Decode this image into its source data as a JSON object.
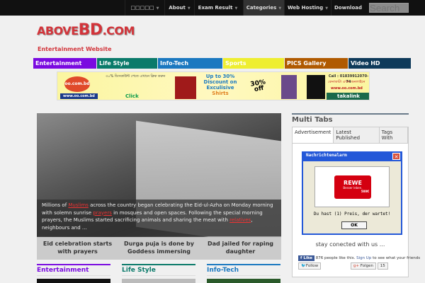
{
  "nav": {
    "items": [
      {
        "label": "□□□□□",
        "caret": true
      },
      {
        "label": "About",
        "caret": true
      },
      {
        "label": "Exam Result",
        "caret": true
      },
      {
        "label": "Categories",
        "caret": true
      },
      {
        "label": "Web Hosting",
        "caret": true
      },
      {
        "label": "Download",
        "caret": false
      }
    ],
    "search_placeholder": "Search"
  },
  "logo": {
    "prefix": "ABOVE",
    "main": "BD",
    "suffix": ".COM"
  },
  "tagline": "Entertainment Website",
  "categories": [
    {
      "label": "Entertainment",
      "color": "#7a0ae0"
    },
    {
      "label": "Life Style",
      "color": "#0a7a6a"
    },
    {
      "label": "Info-Tech",
      "color": "#1a78c0"
    },
    {
      "label": "Sports",
      "color": "#eeee30"
    },
    {
      "label": "PICS Gallery",
      "color": "#b05a00"
    },
    {
      "label": "Video HD",
      "color": "#0e3a5a"
    }
  ],
  "banner": {
    "site": "oo.com.bd",
    "url": "www.oo.com.bd",
    "bangla": "৩০% ডিসকাউন্ট পেতে এখানে ক্লিক করুন",
    "click": "Click",
    "promo1": "Up to 30%",
    "promo2": "Discount on",
    "promo3": "Exculisive",
    "promo4": "Shirts",
    "badge": "30% off",
    "call": "Call : 01839912070-74",
    "call_bn": "কেনাকাটা এখন অনলাইনে",
    "url2": "www.oo.com.bd",
    "takalink": "takalink"
  },
  "slider": {
    "caption_parts": [
      "Millions of ",
      "Muslims",
      " across the country began celebrating the Eid-ul-Azha on Monday morning with solemn sunrise ",
      "prayers",
      " in mosques and open spaces. Following the special morning prayers, the Muslims started sacrificing animals and sharing the meat with ",
      "relatives",
      ", neighbours and …"
    ],
    "tabs": [
      "Eid celebration starts with prayers",
      "Durga puja is done by Goddess immersing",
      "Dad jailed for raping daughter"
    ]
  },
  "sections": [
    {
      "label": "Entertainment",
      "color": "#7a0ae0"
    },
    {
      "label": "Life Style",
      "color": "#0a7a6a"
    },
    {
      "label": "Info-Tech",
      "color": "#1a78c0"
    }
  ],
  "sidebar": {
    "title": "Multi Tabs",
    "tabs": [
      "Advertisement",
      "Latest Published",
      "Tags With"
    ],
    "ad": {
      "title": "Nachrichtenalarm",
      "brand": "REWE",
      "slogan": "Besser leben.",
      "amount": "500€",
      "message": "Du hast (1) Preis, der wartet!",
      "ok": "OK"
    },
    "stay": "stay conected with us ...",
    "fb_like": "Like",
    "fb_text": "876 people like this.",
    "fb_signup": "Sign Up",
    "fb_rest": " to see what your friends",
    "tw_follow": "Follow",
    "gplus": "Folgen",
    "gplus_count": "15"
  }
}
